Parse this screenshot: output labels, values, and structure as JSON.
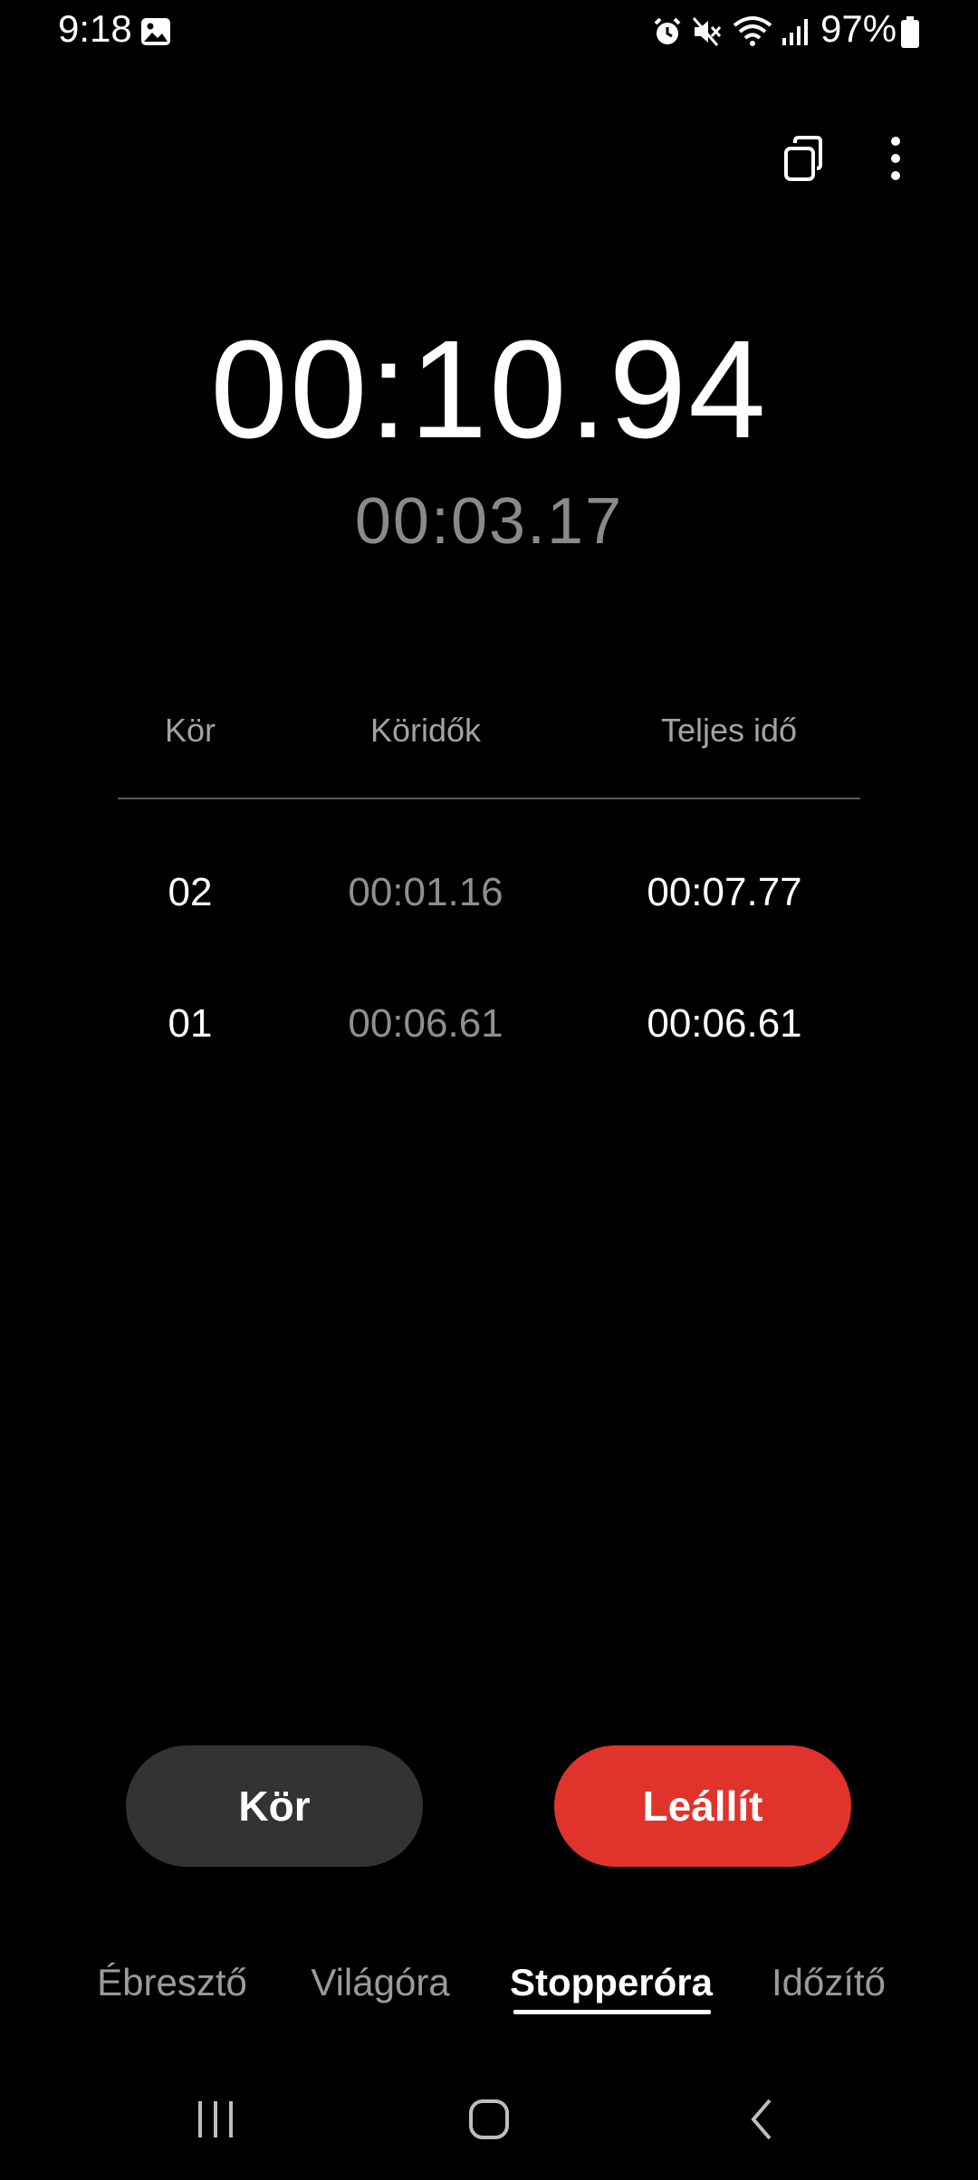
{
  "status_bar": {
    "time": "9:18",
    "battery": "97%",
    "icons": [
      "gallery-icon",
      "alarm-icon",
      "mute-icon",
      "wifi-icon",
      "signal-icon",
      "battery-icon"
    ]
  },
  "actions": {
    "icons": [
      "popup-view-icon",
      "more-options-icon"
    ]
  },
  "stopwatch": {
    "main_time": "00:10.94",
    "current_lap": "00:03.17"
  },
  "laps": {
    "headers": [
      "Kör",
      "Köridők",
      "Teljes idő"
    ],
    "rows": [
      {
        "num": "02",
        "lap": "00:01.16",
        "total": "00:07.77"
      },
      {
        "num": "01",
        "lap": "00:06.61",
        "total": "00:06.61"
      }
    ]
  },
  "buttons": {
    "lap": "Kör",
    "stop": "Leállít",
    "stop_color": "#e0332c"
  },
  "tabs": [
    {
      "label": "Ébresztő",
      "active": false
    },
    {
      "label": "Világóra",
      "active": false
    },
    {
      "label": "Stopperóra",
      "active": true
    },
    {
      "label": "Időzítő",
      "active": false
    }
  ],
  "nav": {
    "icons": [
      "recent-apps-icon",
      "home-icon",
      "back-icon"
    ]
  }
}
